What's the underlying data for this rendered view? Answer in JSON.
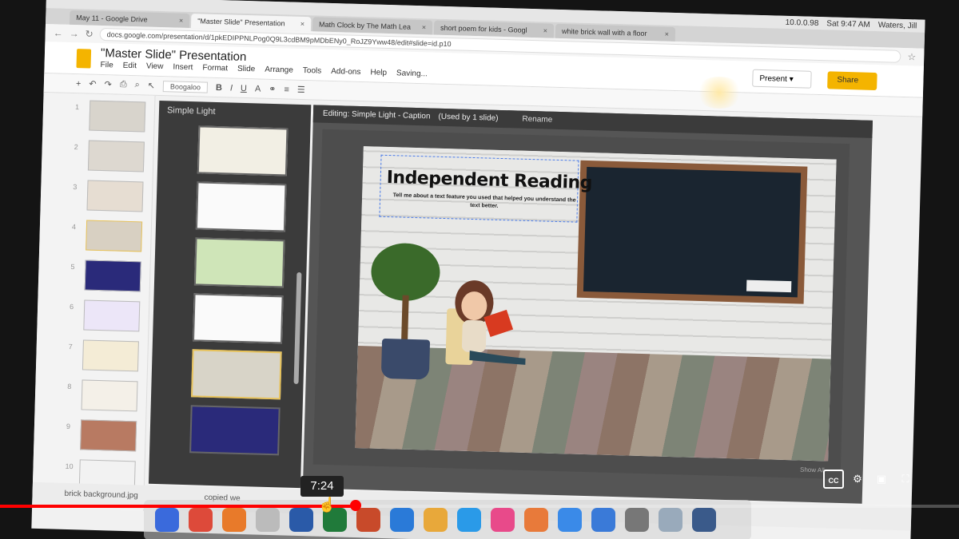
{
  "browser": {
    "tabs": [
      {
        "title": "May 11 - Google Drive",
        "active": false
      },
      {
        "title": "\"Master Slide\" Presentation",
        "active": true
      },
      {
        "title": "Math Clock by The Math Lea",
        "active": false
      },
      {
        "title": "short poem for kids - Googl",
        "active": false
      },
      {
        "title": "white brick wall with a floor",
        "active": false
      }
    ],
    "url": "docs.google.com/presentation/d/1pkEDIPPNLPog0Q9L3cdBM9pMDbENy0_RoJZ9Yww48/edit#slide=id.p10",
    "clock": "Sat 9:47 AM",
    "user": "Waters, Jill",
    "ip": "10.0.0.98"
  },
  "app": {
    "title": "\"Master Slide\" Presentation",
    "menus": [
      "File",
      "Edit",
      "View",
      "Insert",
      "Format",
      "Slide",
      "Arrange",
      "Tools",
      "Add-ons",
      "Help",
      "Saving..."
    ],
    "present_label": "Present",
    "share_label": "Share",
    "font_name": "Boogaloo"
  },
  "filmstrip": {
    "numbers": [
      "1",
      "2",
      "3",
      "4",
      "5",
      "6",
      "7",
      "8",
      "9",
      "10"
    ]
  },
  "layouts_panel": {
    "title": "Simple Light"
  },
  "editor": {
    "editing_label": "Editing: Simple Light - Caption",
    "used_by": "(Used by 1 slide)",
    "rename_label": "Rename",
    "show_all": "Show All"
  },
  "slide": {
    "title": "Independent Reading",
    "caption": "Tell me about a text feature you used that helped you understand the text better."
  },
  "bottom": {
    "filename": "brick background.jpg",
    "status": "copied we"
  },
  "video": {
    "time_tooltip": "7:24",
    "progress_fraction": 0.37
  },
  "colors": {
    "share_button": "#f4b400",
    "progress": "#ff0000",
    "chalkboard": "#1a2530"
  }
}
